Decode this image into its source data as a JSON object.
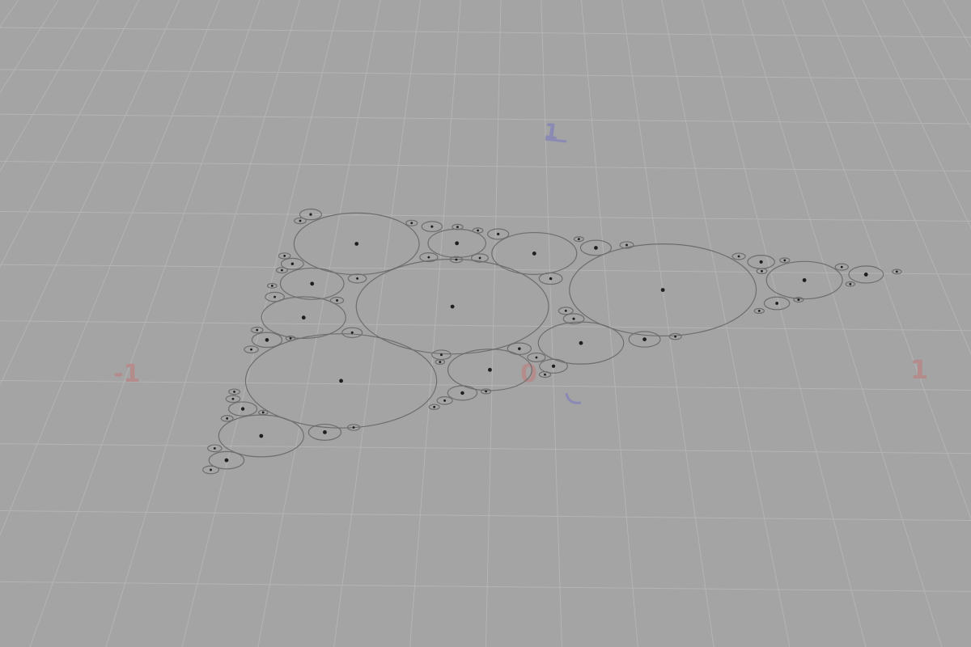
{
  "viewport": {
    "background": "#a4a4a4",
    "grid_color": "#b4b4b4",
    "circle_stroke": "#6e6e6e",
    "dot_color": "#1e1e1e"
  },
  "axes": {
    "x_neg_label": "-1",
    "x_pos_label": "1",
    "origin_label": "0",
    "y_pos_label": "1",
    "x_label_color": "#b48c8c",
    "y_label_color": "#8a8ab4"
  },
  "packing": {
    "shape": "triangle",
    "vertices": [
      [
        -1,
        -0.35
      ],
      [
        1,
        0.1
      ],
      [
        -0.2,
        0.95
      ]
    ],
    "max_depth": 5
  }
}
